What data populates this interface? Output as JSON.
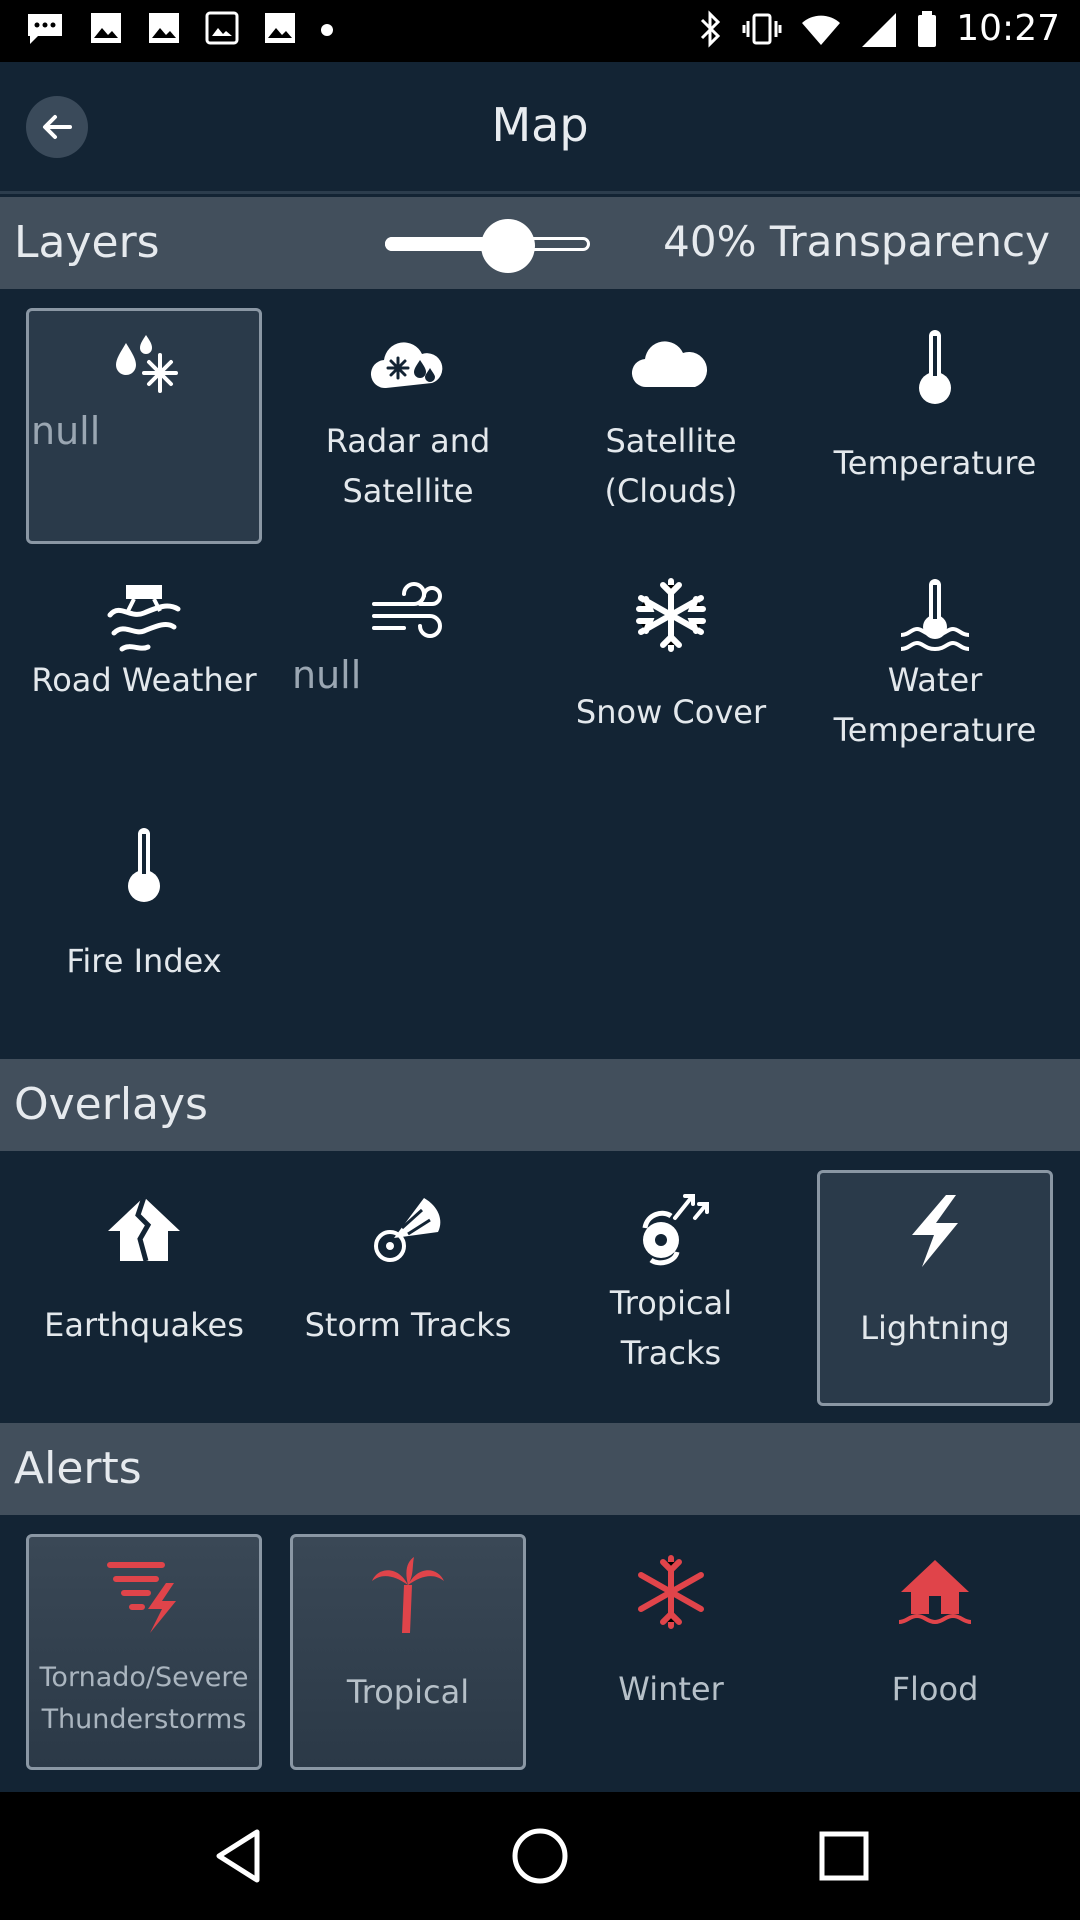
{
  "status": {
    "time": "10:27"
  },
  "header": {
    "title": "Map"
  },
  "layers": {
    "title": "Layers",
    "transparency_value": 0.4,
    "transparency_label": "40% Transparency",
    "items": [
      {
        "label": "null",
        "icon": "precipitation-snow-icon",
        "selected": true
      },
      {
        "label": "Radar and Satellite",
        "icon": "radar-satellite-icon"
      },
      {
        "label": "Satellite (Clouds)",
        "icon": "cloud-icon"
      },
      {
        "label": "Temperature",
        "icon": "thermometer-icon"
      },
      {
        "label": "Road Weather",
        "icon": "road-weather-icon"
      },
      {
        "label": "null",
        "icon": "wind-icon"
      },
      {
        "label": "Snow Cover",
        "icon": "snowflake-icon"
      },
      {
        "label": "Water Temperature",
        "icon": "water-thermometer-icon"
      },
      {
        "label": "Fire Index",
        "icon": "thermometer-icon"
      }
    ]
  },
  "overlays": {
    "title": "Overlays",
    "items": [
      {
        "label": "Earthquakes",
        "icon": "earthquake-icon"
      },
      {
        "label": "Storm Tracks",
        "icon": "storm-tracks-icon"
      },
      {
        "label": "Tropical Tracks",
        "icon": "hurricane-icon"
      },
      {
        "label": "Lightning",
        "icon": "lightning-icon",
        "selected": true
      }
    ]
  },
  "alerts": {
    "title": "Alerts",
    "accent_color": "#e0444a",
    "items": [
      {
        "label_line1": "Tornado/Severe",
        "label_line2": "Thunderstorms",
        "icon": "tornado-icon",
        "selected": true
      },
      {
        "label": "Tropical",
        "icon": "palm-tree-icon",
        "selected": true
      },
      {
        "label": "Winter",
        "icon": "snowflake-icon"
      },
      {
        "label": "Flood",
        "icon": "flood-house-icon"
      }
    ]
  }
}
